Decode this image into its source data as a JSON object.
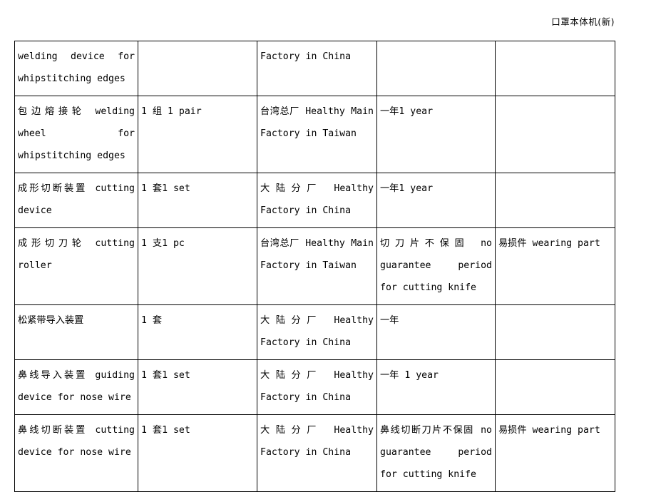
{
  "header": {
    "title": "口罩本体机(新)"
  },
  "table": {
    "columns": [
      "part-name",
      "quantity",
      "origin-factory",
      "warranty",
      "remark"
    ],
    "rows": [
      {
        "name": "welding device for whipstitching edges",
        "quantity": "",
        "factory": "Factory  in China",
        "warranty": "",
        "remark": ""
      },
      {
        "name": "包边熔接轮 welding wheel for whipstitching edges",
        "quantity": "1 组 1 pair",
        "factory": "台湾总厂 Healthy Main Factory in Taiwan",
        "warranty": "一年1 year",
        "remark": ""
      },
      {
        "name": "成形切断装置 cutting device",
        "quantity": "1 套1 set",
        "factory": "大陆分厂 Healthy Factory in China",
        "warranty": "一年1 year",
        "remark": ""
      },
      {
        "name": "成形切刀轮 cutting roller",
        "quantity": "1 支1 pc",
        "factory": "台湾总厂 Healthy Main Factory in Taiwan",
        "warranty": "切刀片不保固 no guarantee period for cutting knife",
        "remark": "易损件 wearing part"
      },
      {
        "name": "松紧带导入装置",
        "quantity": "1 套",
        "factory": "大陆分厂 Healthy Factory in China",
        "warranty": "一年",
        "remark": ""
      },
      {
        "name": "鼻线导入装置 guiding device for nose wire",
        "quantity": "1 套1 set",
        "factory": "大陆分厂 Healthy Factory in China",
        "warranty": "一年 1 year",
        "remark": ""
      },
      {
        "name": "鼻线切断装置 cutting device for nose wire",
        "quantity": "1 套1 set",
        "factory": "大陆分厂 Healthy Factory in China",
        "warranty": "鼻线切断刀片不保固 no guarantee period for cutting knife",
        "remark": "易损件 wearing part"
      }
    ]
  }
}
